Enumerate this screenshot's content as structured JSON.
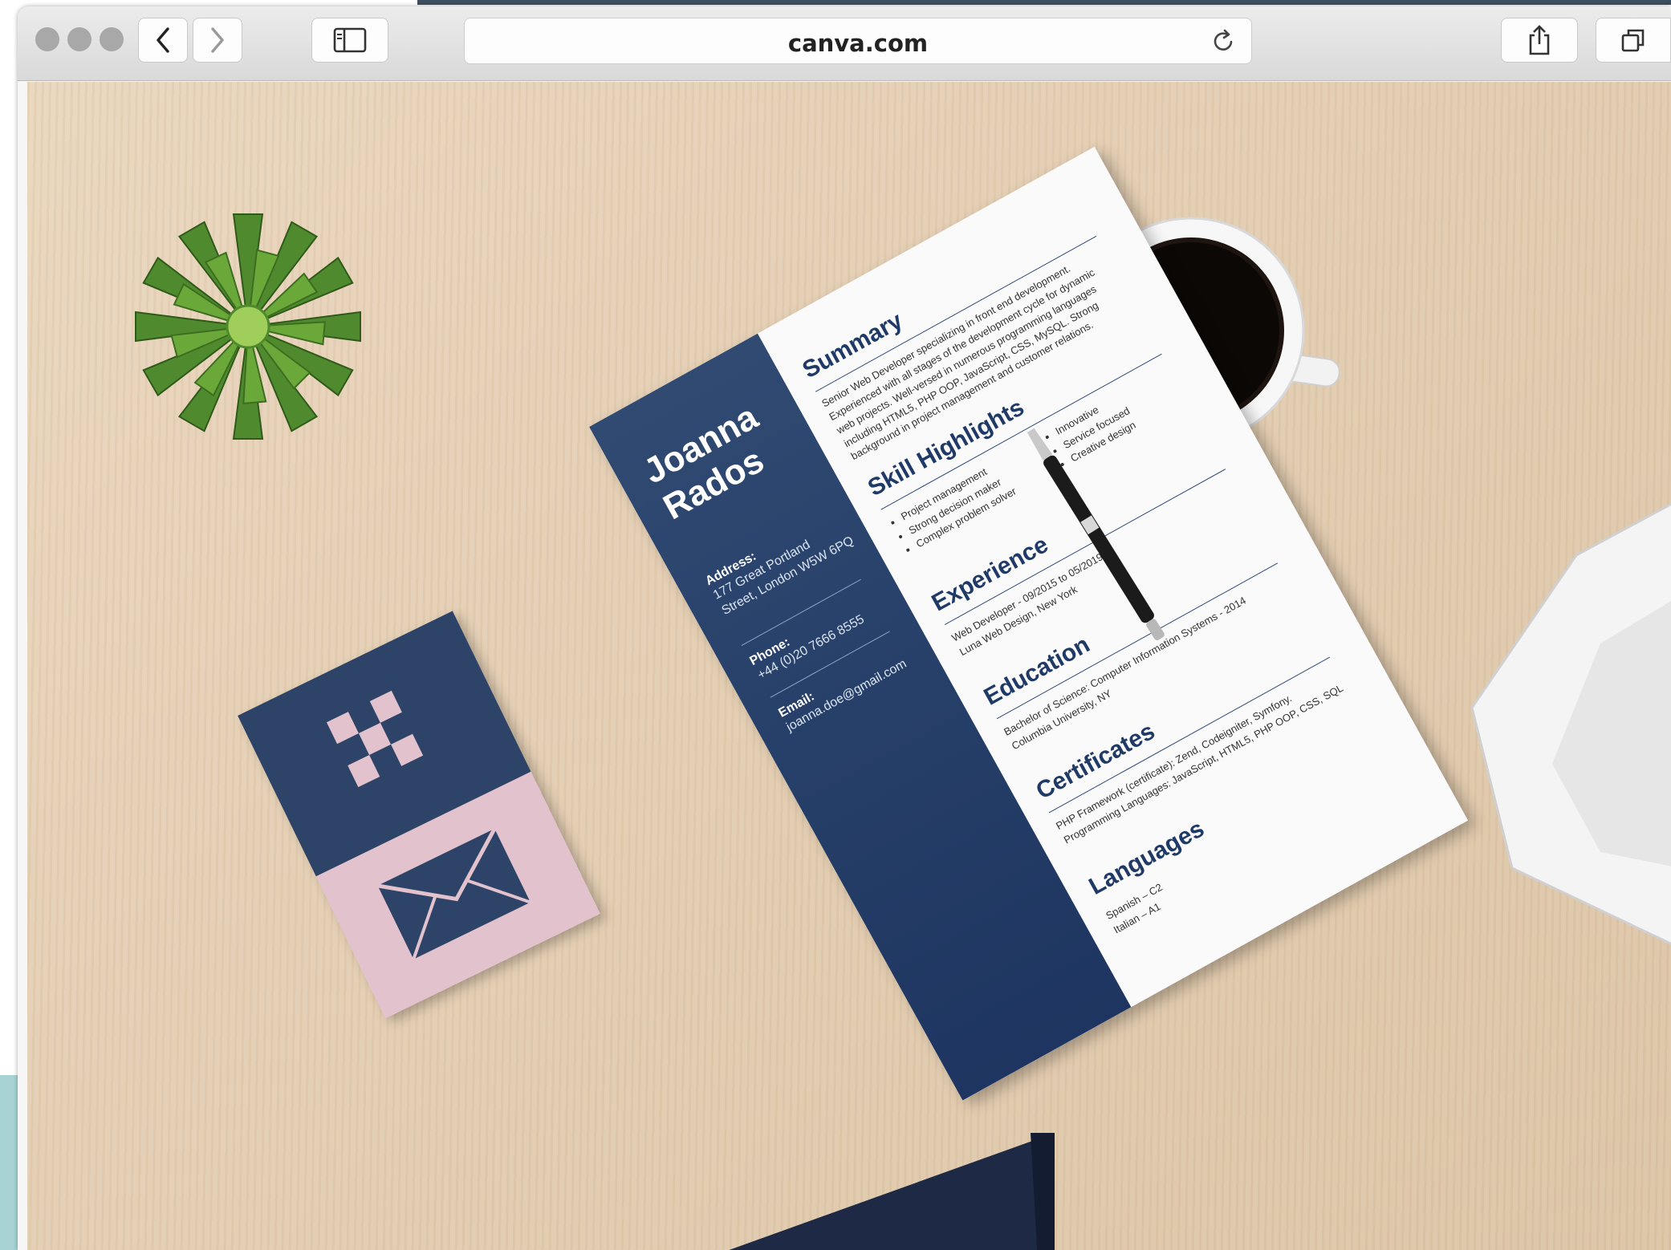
{
  "browser": {
    "url": "canva.com",
    "back_icon": "chevron-left-icon",
    "forward_icon": "chevron-right-icon",
    "sidebar_icon": "sidebar-icon",
    "reload_icon": "reload-icon",
    "share_icon": "share-icon",
    "tabs_icon": "tabs-icon"
  },
  "resume": {
    "name_first": "Joanna",
    "name_last": "Rados",
    "address_label": "Address:",
    "address_value": "177 Great Portland Street, London W5W 6PQ",
    "phone_label": "Phone:",
    "phone_value": "+44 (0)20 7666 8555",
    "email_label": "Email:",
    "email_value": "joanna.doe@gmail.com",
    "summary_heading": "Summary",
    "summary_text": "Senior Web Developer specializing in front end development. Experienced with all stages of the development cycle for dynamic web projects. Well-versed in numerous programming languages including HTML5, PHP OOP, JavaScript, CSS, MySQL. Strong background in project management and customer relations.",
    "skills_heading": "Skill Highlights",
    "skills_left": [
      "Project management",
      "Strong decision maker",
      "Complex problem solver"
    ],
    "skills_right": [
      "Innovative",
      "Service focused",
      "Creative design"
    ],
    "experience_heading": "Experience",
    "experience_line1": "Web Developer - 09/2015 to 05/2019",
    "experience_line2": "Luna Web Design, New York",
    "education_heading": "Education",
    "education_line1": "Bachelor of Science: Computer Information Systems - 2014",
    "education_line2": "Columbia University, NY",
    "certificates_heading": "Certificates",
    "certificates_line1": "PHP Framework (certificate): Zend, Codeigniter, Symfony.",
    "certificates_line2": "Programming Languages: JavaScript, HTML5, PHP OOP, CSS, SQL",
    "languages_heading": "Languages",
    "languages": [
      "Spanish – C2",
      "Italian – A1"
    ]
  },
  "colors": {
    "navy": "#2d4468",
    "pink": "#e2c2cc",
    "desk": "#e3cdb1"
  }
}
